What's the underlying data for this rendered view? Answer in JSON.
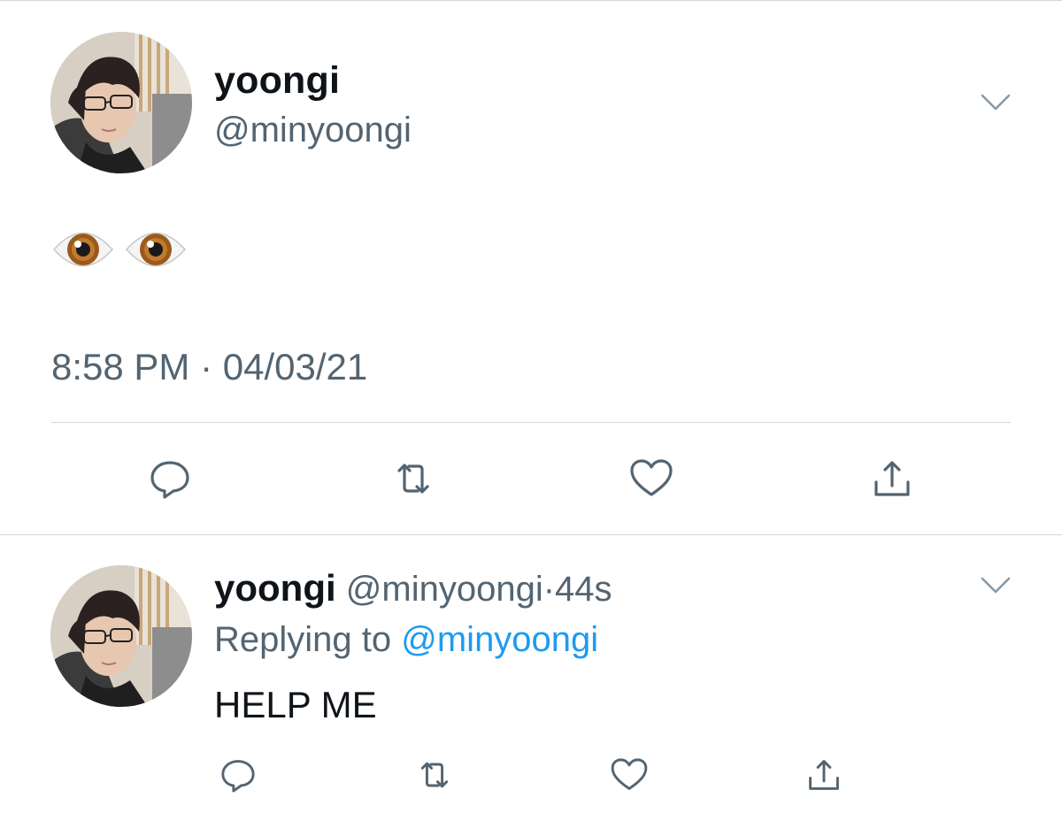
{
  "main_tweet": {
    "display_name": "yoongi",
    "handle": "@minyoongi",
    "text_icons": [
      "eye-emoji",
      "eye-emoji"
    ],
    "timestamp": "8:58 PM · 04/03/21",
    "actions": [
      "reply-icon",
      "retweet-icon",
      "like-icon",
      "share-icon"
    ]
  },
  "reply_tweet": {
    "display_name": "yoongi",
    "handle": "@minyoongi",
    "separator": "·",
    "time_ago": "44s",
    "replying_prefix": "Replying to",
    "replying_to": "@minyoongi",
    "text": "HELP ME",
    "actions": [
      "reply-icon",
      "retweet-icon",
      "like-icon",
      "share-icon"
    ]
  },
  "colors": {
    "text_primary": "#0f1419",
    "text_secondary": "#536471",
    "link": "#1d9bf0",
    "divider": "#cfd9de"
  }
}
